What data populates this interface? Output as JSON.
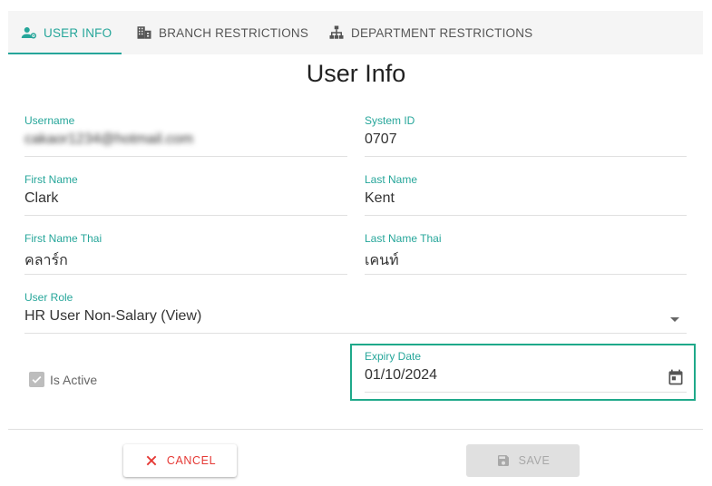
{
  "tabs": [
    {
      "label": "USER INFO",
      "icon": "user-settings-icon",
      "active": true
    },
    {
      "label": "BRANCH RESTRICTIONS",
      "icon": "building-icon",
      "active": false
    },
    {
      "label": "DEPARTMENT RESTRICTIONS",
      "icon": "sitemap-icon",
      "active": false
    }
  ],
  "title": "User Info",
  "fields": {
    "username": {
      "label": "Username",
      "value": "cakaor1234@hotmail.com"
    },
    "system_id": {
      "label": "System ID",
      "value": "0707"
    },
    "first_name": {
      "label": "First Name",
      "value": "Clark"
    },
    "last_name": {
      "label": "Last Name",
      "value": "Kent"
    },
    "first_name_thai": {
      "label": "First Name Thai",
      "value": "คลาร์ก"
    },
    "last_name_thai": {
      "label": "Last Name Thai",
      "value": "เคนท์"
    },
    "user_role": {
      "label": "User Role",
      "value": "HR User Non-Salary (View)"
    },
    "expiry_date": {
      "label": "Expiry Date",
      "value": "01/10/2024"
    }
  },
  "is_active": {
    "label": "Is Active",
    "checked": true
  },
  "actions": {
    "cancel_label": "CANCEL",
    "save_label": "SAVE"
  },
  "colors": {
    "accent": "#26a69a",
    "highlight_border": "#1fa98a",
    "cancel": "#e53935",
    "disabled": "#a8a8a8"
  }
}
